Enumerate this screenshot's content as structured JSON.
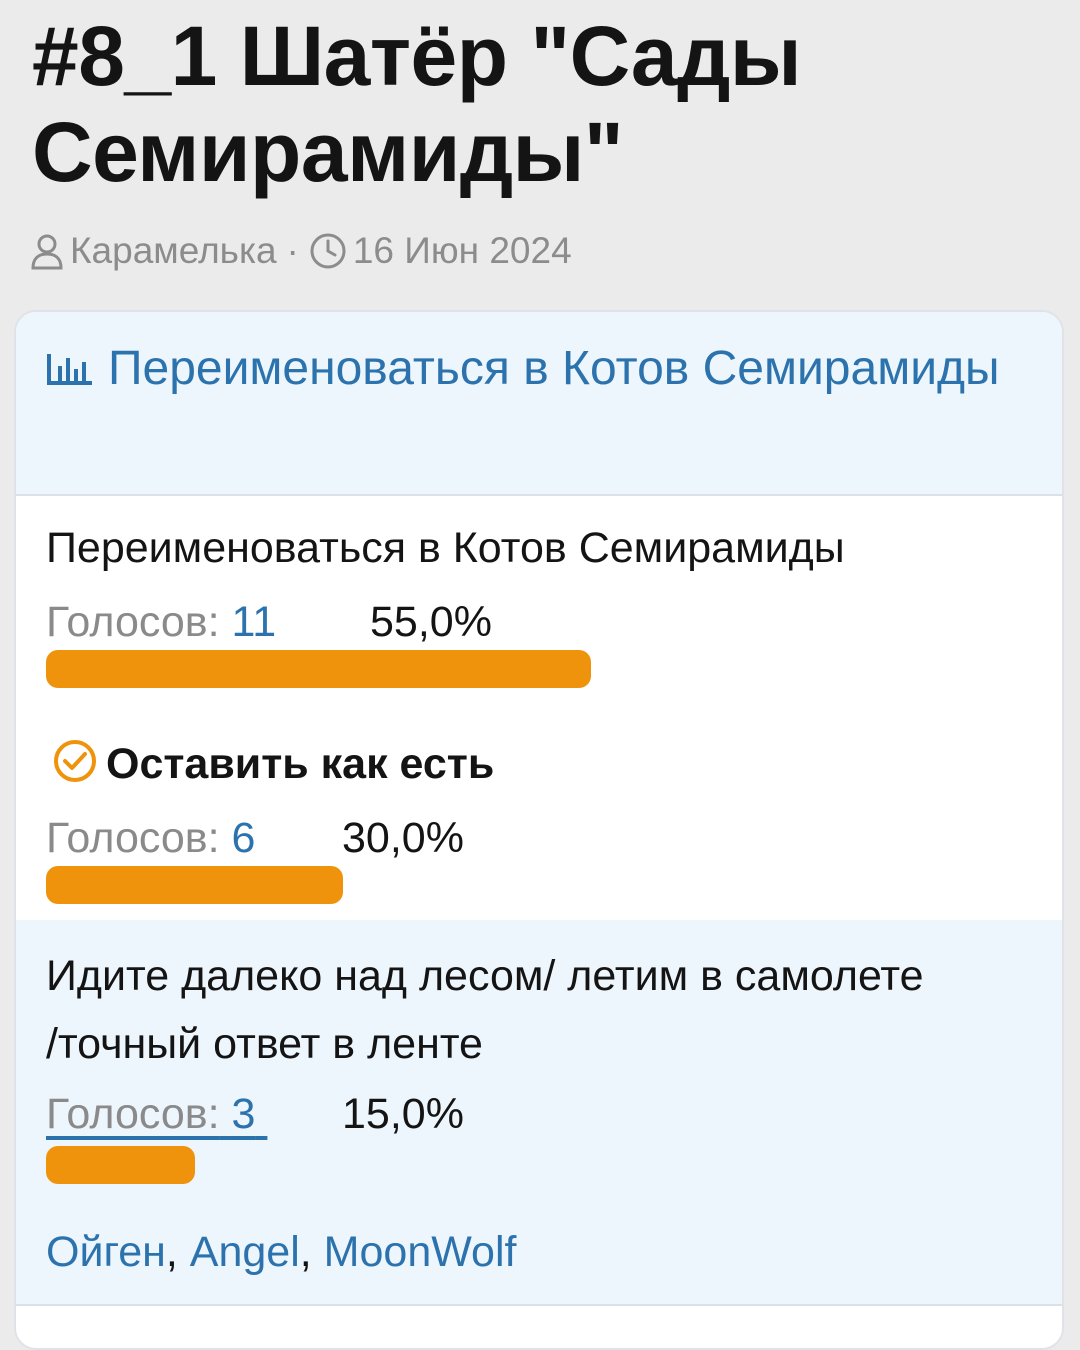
{
  "thread": {
    "title": "#8_1 Шатёр \"Сады Семирамиды\"",
    "author": "Карамелька",
    "separator": "·",
    "date": "16 Июн 2024"
  },
  "poll": {
    "question": "Переименоваться в Котов Семирамиды",
    "votes_label": "Голосов:",
    "options": [
      {
        "label": "Переименоваться в Котов Семирамиды",
        "votes": "11",
        "percent": "55,0%",
        "fraction": 0.55,
        "voted": false
      },
      {
        "label": "Оставить как есть",
        "votes": "6",
        "percent": "30,0%",
        "fraction": 0.3,
        "voted": true
      },
      {
        "label": "Идите далеко над лесом/ летим в самолете /точный ответ в ленте",
        "votes": "3",
        "percent": "15,0%",
        "fraction": 0.15,
        "voted": false,
        "voters": [
          "Ойген",
          "Angel",
          "MoonWolf"
        ],
        "voters_separator": ", "
      }
    ]
  },
  "colors": {
    "accent": "#2c73ad",
    "bar": "#f0930c",
    "highlight_bg": "#edf5fd"
  },
  "icons": {
    "author": "user-icon",
    "date": "clock-icon",
    "poll": "bar-chart-icon",
    "voted": "check-circle-icon"
  }
}
